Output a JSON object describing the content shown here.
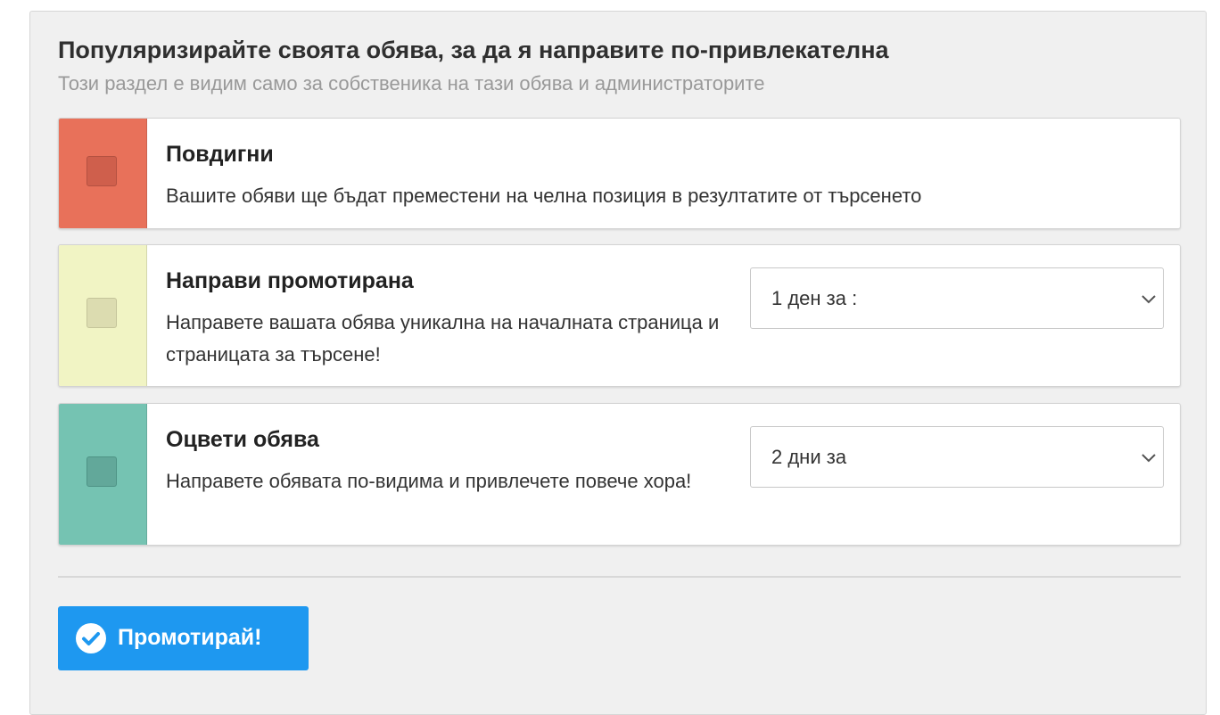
{
  "header": {
    "title": "Популяризирайте своята обява, за да я направите по-привлекателна",
    "subtitle": "Този раздел е видим само за собственика на тази обява и администраторите"
  },
  "options": [
    {
      "title": "Повдигни",
      "description": "Вашите обяви ще бъдат преместени на челна позиция в резултатите от търсенето",
      "accent_color": "#e8715a",
      "checkbox_color": "#cf5f4c",
      "checked": false
    },
    {
      "title": "Направи промотирана",
      "description": "Направете вашата обява уникална на началната страница и страницата за търсене!",
      "accent_color": "#f1f4c4",
      "checkbox_color": "#dcdcb0",
      "checked": false,
      "select_value": "1 ден за :"
    },
    {
      "title": "Оцвети обява",
      "description": "Направете обявата по-видима и привлечете повече хора!",
      "accent_color": "#75c3b2",
      "checkbox_color": "#62a89a",
      "checked": false,
      "select_value": "2 дни за"
    }
  ],
  "actions": {
    "promote_label": "Промотирай!",
    "promote_color": "#1e98f0"
  },
  "icons": {
    "checkbox": "checkbox-icon",
    "dropdown": "chevron-down-icon",
    "button": "check-circle-icon"
  }
}
